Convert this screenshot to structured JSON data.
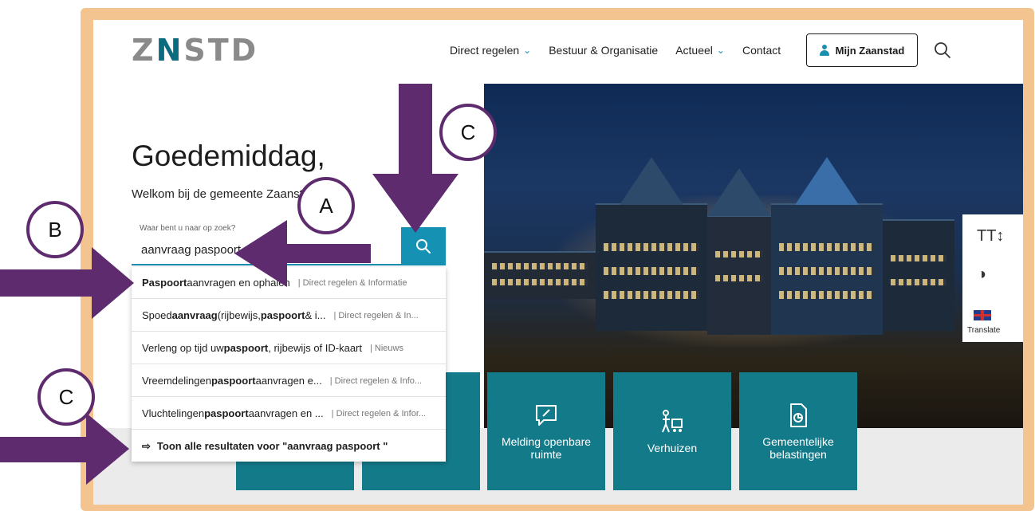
{
  "header": {
    "logo_left": "Z",
    "logo_n": "N",
    "logo_right": "STD",
    "nav": [
      {
        "label": "Direct regelen",
        "has_dropdown": true
      },
      {
        "label": "Bestuur & Organisatie",
        "has_dropdown": false
      },
      {
        "label": "Actueel",
        "has_dropdown": true
      },
      {
        "label": "Contact",
        "has_dropdown": false
      }
    ],
    "account_button": "Mijn Zaanstad",
    "search_icon": "search-icon"
  },
  "hero": {
    "greeting": "Goedemiddag,",
    "welcome": "Welkom bij de gemeente Zaanst"
  },
  "search": {
    "label": "Waar bent u naar op zoek?",
    "value": "aanvraag paspoort",
    "button_icon": "search-icon"
  },
  "suggestions": [
    {
      "pre": "",
      "b1": "Paspoort",
      "mid": " aanvragen en ophalen",
      "b2": "",
      "post": "",
      "category": "| Direct regelen & Informatie"
    },
    {
      "pre": "Spoed",
      "b1": "aanvraag",
      "mid": " (rijbewijs, ",
      "b2": "paspoort",
      "post": " & i...",
      "category": "| Direct regelen & In..."
    },
    {
      "pre": "Verleng op tijd uw ",
      "b1": "paspoort",
      "mid": ", rijbewijs of ID-kaart",
      "b2": "",
      "post": "",
      "category": "| Nieuws"
    },
    {
      "pre": "Vreemdelingen",
      "b1": "paspoort",
      "mid": " aanvragen e...",
      "b2": "",
      "post": "",
      "category": "| Direct regelen & Info..."
    },
    {
      "pre": "Vluchtelingen",
      "b1": "paspoort",
      "mid": " aanvragen en ...",
      "b2": "",
      "post": "",
      "category": "| Direct regelen & Infor..."
    }
  ],
  "show_all": "Toon alle resultaten voor \"aanvraag paspoort \"",
  "accessibility_tools": {
    "text_size_glyph": "TT↕",
    "contrast_icon": "contrast-icon",
    "translate_label": "Translate"
  },
  "tiles": [
    {
      "label": "",
      "icon": ""
    },
    {
      "label": "",
      "icon": ""
    },
    {
      "label": "Melding openbare ruimte",
      "icon": "chat-pen-icon"
    },
    {
      "label": "Verhuizen",
      "icon": "moving-person-icon"
    },
    {
      "label": "Gemeentelijke belastingen",
      "icon": "document-chart-icon"
    }
  ],
  "annotations": {
    "a": "A",
    "b": "B",
    "c1": "C",
    "c2": "C"
  },
  "colors": {
    "frame": "#f3c48f",
    "accent": "#1591b4",
    "tile": "#137a8a",
    "annotation": "#5e2b6e"
  }
}
